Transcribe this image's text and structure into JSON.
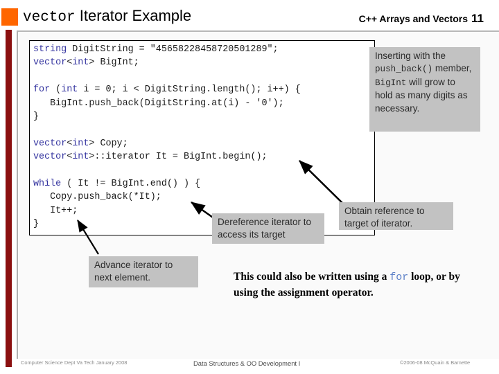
{
  "header": {
    "title_mono": "vector",
    "title_rest": " Iterator Example",
    "course": "C++ Arrays and Vectors",
    "page_number": "11",
    "square_color": "#ff6600"
  },
  "code": {
    "lines": [
      "string DigitString = \"45658228458720501289\";",
      "vector<int> BigInt;",
      "",
      "for (int i = 0; i < DigitString.length(); i++) {",
      "   BigInt.push_back(DigitString.at(i) - '0');",
      "}",
      "",
      "vector<int> Copy;",
      "vector<int>::iterator It = BigInt.begin();",
      "",
      "while ( It != BigInt.end() ) {",
      "   Copy.push_back(*It);",
      "   It++;",
      "}"
    ],
    "digit_string": "45658228458720501289",
    "keywords": [
      "string",
      "vector",
      "for",
      "int",
      "while"
    ],
    "keyword_color": "#33339f"
  },
  "callouts": {
    "insert": {
      "line1": "Inserting with the ",
      "mono1": "push_back()",
      "line2": " member, ",
      "mono2": "BigInt",
      "line3": " will grow to hold as many digits as necessary."
    },
    "dereference": "Dereference iterator to access its target",
    "obtain": "Obtain reference to target of iterator.",
    "advance": "Advance iterator to next element.",
    "background_color": "#c2c2c2"
  },
  "note": {
    "part1": "This could also be written using a ",
    "mono": "for",
    "part2": " loop, or by using the assignment operator."
  },
  "footer": {
    "left": "Computer Science Dept Va Tech January 2008",
    "center": "Data Structures & OO Development I",
    "right": "©2006-08  McQuain & Barnette"
  }
}
